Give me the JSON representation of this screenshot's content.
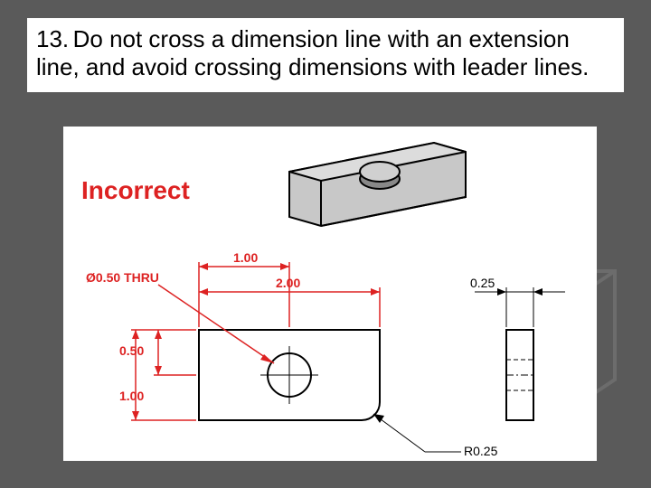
{
  "header": {
    "number": "13.",
    "text": "Do not cross a dimension line with an extension line, and avoid crossing dimensions with leader lines."
  },
  "incorrect_label": "Incorrect",
  "dims": {
    "thru": "Ø0.50 THRU",
    "w1": "1.00",
    "w2": "2.00",
    "h1": "0.50",
    "h2": "1.00",
    "thk": "0.25",
    "rad": "R0.25"
  }
}
